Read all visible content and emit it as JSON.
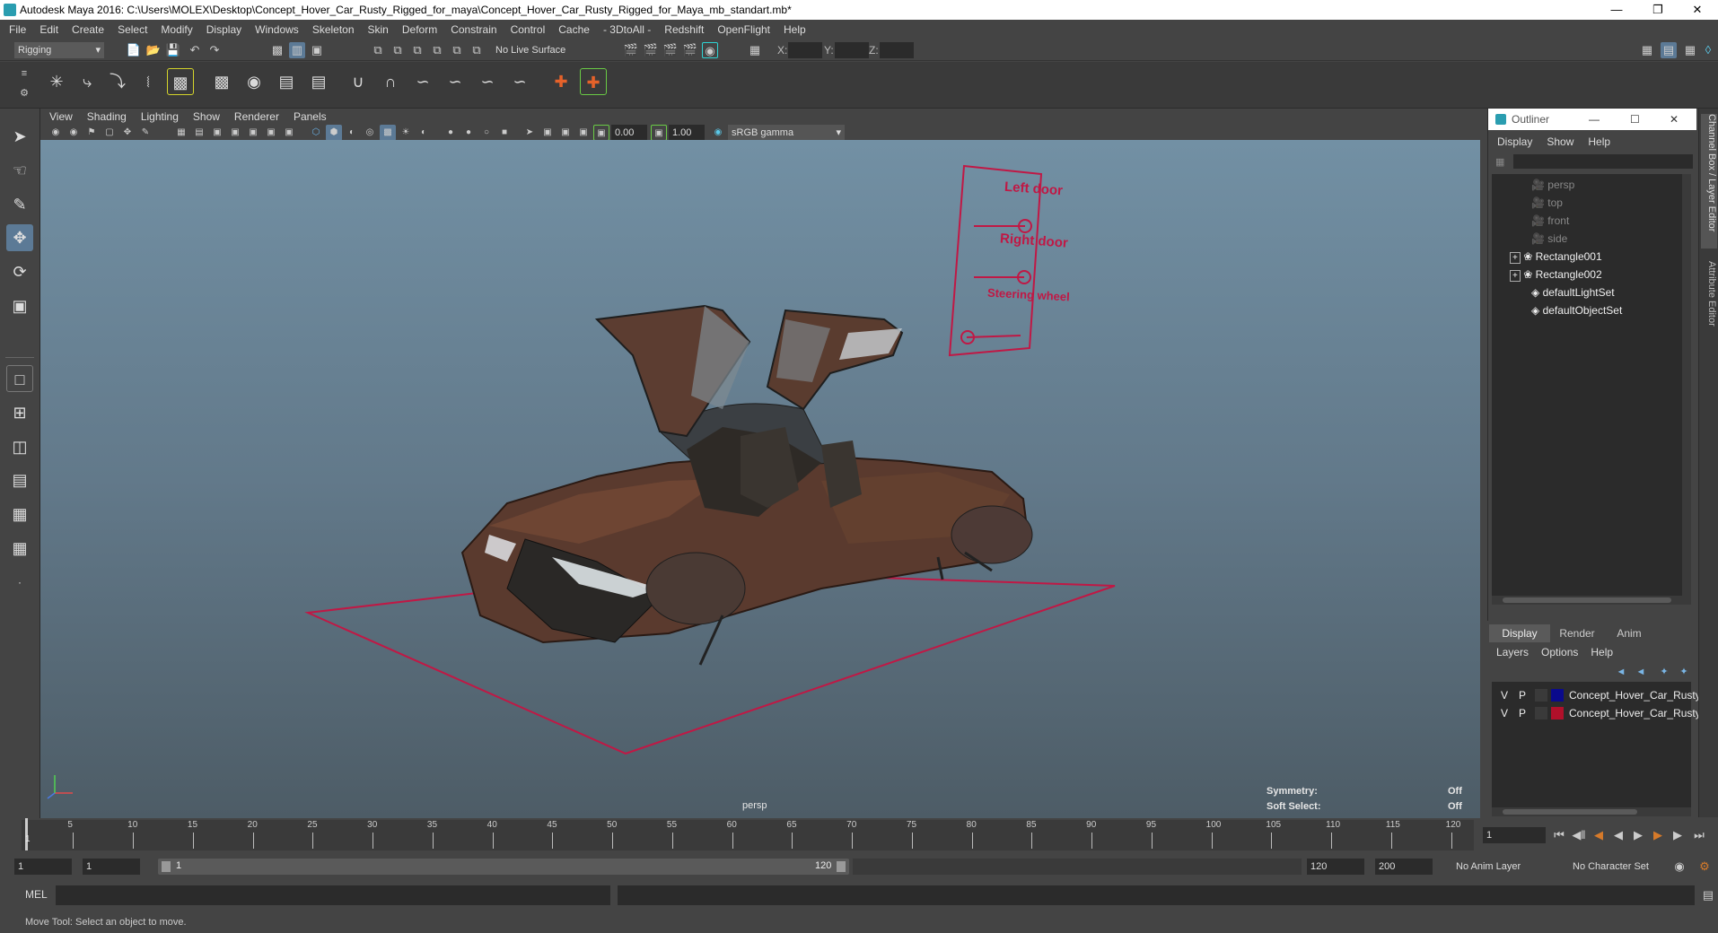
{
  "window": {
    "title": "Autodesk Maya 2016: C:\\Users\\MOLEX\\Desktop\\Concept_Hover_Car_Rusty_Rigged_for_maya\\Concept_Hover_Car_Rusty_Rigged_for_Maya_mb_standart.mb*"
  },
  "menubar": [
    "File",
    "Edit",
    "Create",
    "Select",
    "Modify",
    "Display",
    "Windows",
    "Skeleton",
    "Skin",
    "Deform",
    "Constrain",
    "Control",
    "Cache",
    "- 3DtoAll -",
    "Redshift",
    "OpenFlight",
    "Help"
  ],
  "statusline": {
    "mode": "Rigging",
    "live_surface": "No Live Surface",
    "x_label": "X:",
    "y_label": "Y:",
    "z_label": "Z:"
  },
  "panel": {
    "menu": [
      "View",
      "Shading",
      "Lighting",
      "Show",
      "Renderer",
      "Panels"
    ],
    "exposure": "0.00",
    "gamma": "1.00",
    "colorspace": "sRGB gamma",
    "camera_label": "persp",
    "hud": {
      "symmetry_label": "Symmetry:",
      "symmetry_value": "Off",
      "soft_select_label": "Soft Select:",
      "soft_select_value": "Off"
    }
  },
  "scene": {
    "rig_labels": [
      "Left door",
      "Right door",
      "Steering wheel"
    ]
  },
  "outliner": {
    "title": "Outliner",
    "menu": [
      "Display",
      "Show",
      "Help"
    ],
    "items": [
      {
        "label": "persp",
        "type": "camera",
        "dim": true
      },
      {
        "label": "top",
        "type": "camera",
        "dim": true
      },
      {
        "label": "front",
        "type": "camera",
        "dim": true
      },
      {
        "label": "side",
        "type": "camera",
        "dim": true
      },
      {
        "label": "Rectangle001",
        "type": "transform",
        "dim": false
      },
      {
        "label": "Rectangle002",
        "type": "transform",
        "dim": false
      },
      {
        "label": "defaultLightSet",
        "type": "set",
        "dim": false
      },
      {
        "label": "defaultObjectSet",
        "type": "set",
        "dim": false
      }
    ]
  },
  "layer_editor": {
    "tabs": [
      "Display",
      "Render",
      "Anim"
    ],
    "menu": [
      "Layers",
      "Options",
      "Help"
    ],
    "layers": [
      {
        "v": "V",
        "p": "P",
        "color": "#0a0a8c",
        "name": "Concept_Hover_Car_Rusty_"
      },
      {
        "v": "V",
        "p": "P",
        "color": "#b0102a",
        "name": "Concept_Hover_Car_Rusty_"
      }
    ]
  },
  "side_tabs": {
    "channel_box": "Channel Box / Layer Editor",
    "attribute_editor": "Attribute Editor"
  },
  "timeline": {
    "ticks": [
      "5",
      "10",
      "15",
      "20",
      "25",
      "30",
      "35",
      "40",
      "45",
      "50",
      "55",
      "60",
      "65",
      "70",
      "75",
      "80",
      "85",
      "90",
      "95",
      "100",
      "105",
      "110",
      "115",
      "120"
    ],
    "start_tick": "1",
    "current_frame": "1"
  },
  "range": {
    "start": "1",
    "playback_start": "1",
    "slider_start": "1",
    "slider_end": "120",
    "playback_end": "120",
    "end": "200",
    "anim_layer": "No Anim Layer",
    "character_set": "No Character Set"
  },
  "mel": {
    "label": "MEL"
  },
  "help_line": "Move Tool: Select an object to move."
}
